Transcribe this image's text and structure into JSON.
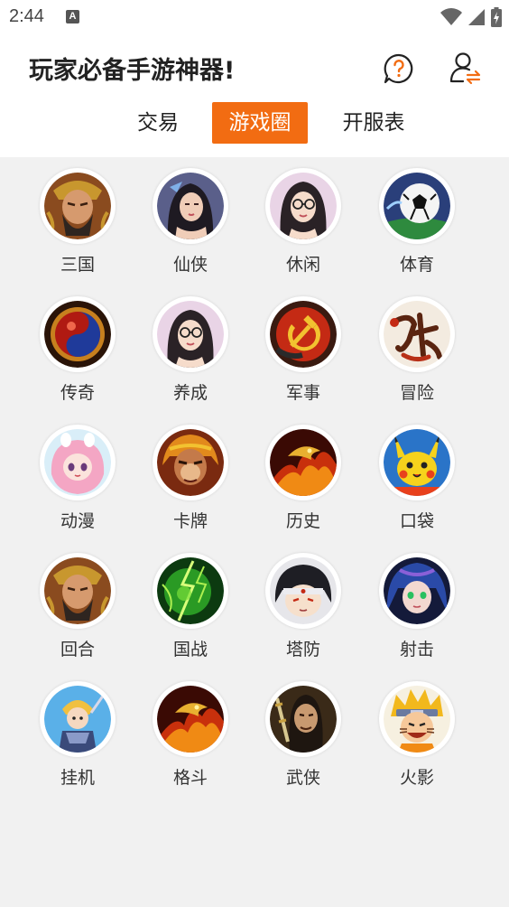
{
  "status_bar": {
    "time": "2:44",
    "notification_icon": "A"
  },
  "header": {
    "title": "玩家必备手游神器!",
    "help_icon": "question-bubble-icon",
    "user_icon": "user-switch-icon",
    "accent_color": "#f26c12"
  },
  "tabs": [
    {
      "label": "交易",
      "active": false
    },
    {
      "label": "游戏圈",
      "active": true
    },
    {
      "label": "开服表",
      "active": false
    }
  ],
  "categories": [
    {
      "label": "三国",
      "icon": "warrior-guanyu-icon"
    },
    {
      "label": "仙侠",
      "icon": "fairy-woman-icon"
    },
    {
      "label": "休闲",
      "icon": "girl-glasses-icon"
    },
    {
      "label": "体育",
      "icon": "soccer-ball-icon"
    },
    {
      "label": "传奇",
      "icon": "red-gem-icon"
    },
    {
      "label": "养成",
      "icon": "girl-glasses-icon"
    },
    {
      "label": "军事",
      "icon": "hammer-sickle-icon"
    },
    {
      "label": "冒险",
      "icon": "calligraphy-emblem-icon"
    },
    {
      "label": "动漫",
      "icon": "pink-anime-girl-icon"
    },
    {
      "label": "卡牌",
      "icon": "monkey-king-icon"
    },
    {
      "label": "历史",
      "icon": "fire-dragon-icon"
    },
    {
      "label": "口袋",
      "icon": "pikachu-icon"
    },
    {
      "label": "回合",
      "icon": "warrior-guanyu-icon"
    },
    {
      "label": "国战",
      "icon": "green-lightning-icon"
    },
    {
      "label": "塔防",
      "icon": "ninja-boy-icon"
    },
    {
      "label": "射击",
      "icon": "blue-hair-girl-icon"
    },
    {
      "label": "挂机",
      "icon": "knight-hero-icon"
    },
    {
      "label": "格斗",
      "icon": "fire-dragon-icon"
    },
    {
      "label": "武侠",
      "icon": "swordsman-icon"
    },
    {
      "label": "火影",
      "icon": "naruto-icon"
    }
  ]
}
